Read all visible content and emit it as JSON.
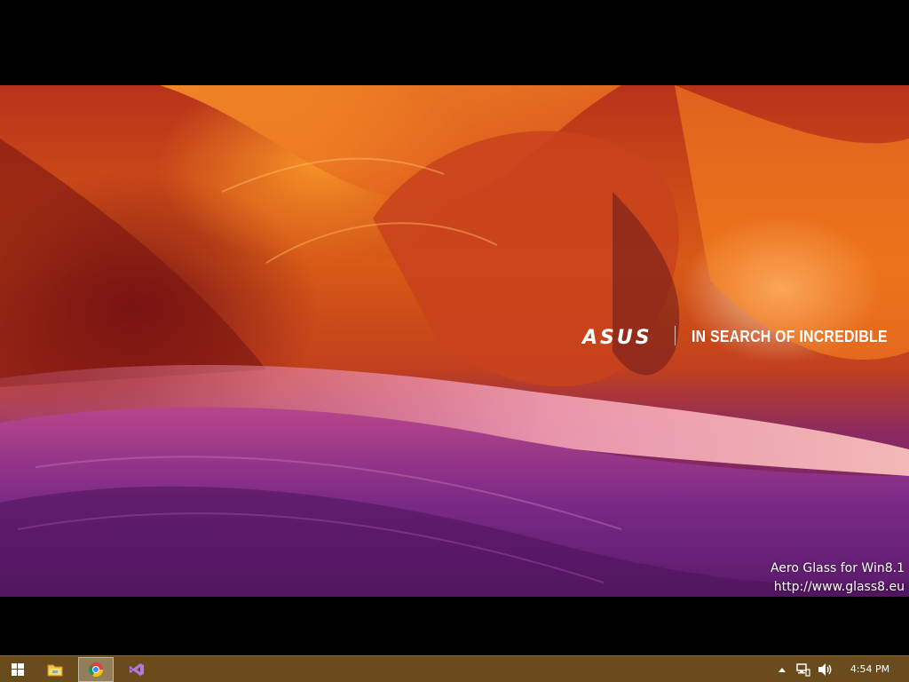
{
  "wallpaper": {
    "brand": "ASUS",
    "tagline": "IN SEARCH OF INCREDIBLE"
  },
  "watermark": {
    "line1": "Aero Glass for Win8.1",
    "line2": "http://www.glass8.eu"
  },
  "taskbar": {
    "background": "#6a4b1c",
    "pinned": [
      {
        "name": "start-button",
        "icon": "windows-logo-icon"
      },
      {
        "name": "file-explorer",
        "icon": "folder-icon"
      },
      {
        "name": "google-chrome",
        "icon": "chrome-icon",
        "active": true
      },
      {
        "name": "visual-studio",
        "icon": "visual-studio-icon"
      }
    ],
    "tray": {
      "icons": [
        "chevron-up-icon",
        "network-icon",
        "volume-icon"
      ],
      "time": "4:54 PM"
    }
  }
}
